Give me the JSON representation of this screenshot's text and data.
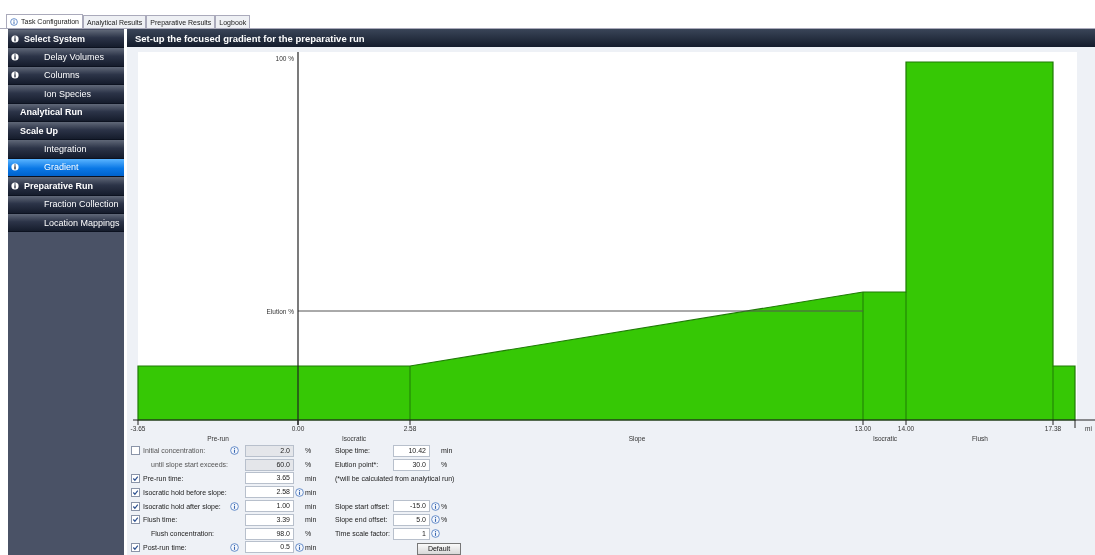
{
  "tabs": [
    {
      "label": "Task Configuration",
      "info": true,
      "selected": true
    },
    {
      "label": "Analytical Results",
      "info": false,
      "selected": false
    },
    {
      "label": "Preparative Results",
      "info": false,
      "selected": false
    },
    {
      "label": "Logbook",
      "info": false,
      "selected": false
    }
  ],
  "sidebar": {
    "items": [
      {
        "label": "Select System",
        "info": true,
        "selected": false,
        "children": [
          {
            "label": "Delay Volumes",
            "info": true,
            "selected": false
          },
          {
            "label": "Columns",
            "info": true,
            "selected": false
          },
          {
            "label": "Ion Species",
            "info": false,
            "selected": false
          }
        ]
      },
      {
        "label": "Analytical Run",
        "info": false,
        "selected": false
      },
      {
        "label": "Scale Up",
        "info": false,
        "selected": false,
        "children": [
          {
            "label": "Integration",
            "info": false,
            "selected": false
          },
          {
            "label": "Gradient",
            "info": true,
            "selected": true
          }
        ]
      },
      {
        "label": "Preparative Run",
        "info": true,
        "selected": false,
        "children": [
          {
            "label": "Fraction Collection",
            "info": false,
            "selected": false
          },
          {
            "label": "Location Mappings",
            "info": false,
            "selected": false
          }
        ]
      }
    ]
  },
  "panel": {
    "title": "Set-up the focused gradient for the preparative run",
    "chart": {
      "y_labels": [
        "100 %",
        "Elution %"
      ],
      "x_tick_labels": [
        "-3.65",
        "0.00",
        "2.58",
        "13.00",
        "14.00",
        "17.38"
      ],
      "x_unit": "mi",
      "segment_labels": [
        "Pre-run",
        "Isocratic",
        "Slope",
        "Isocratic",
        "Flush"
      ]
    },
    "left_fields": [
      {
        "kind": "check",
        "checked": false,
        "label": "Initial concentration:",
        "info_label": true,
        "value": "2.0",
        "disabled": true,
        "info_value": false,
        "unit": "%"
      },
      {
        "kind": "plain",
        "label": "until slope start exceeds:",
        "info_label": false,
        "value": "60.0",
        "disabled": true,
        "info_value": false,
        "unit": "%"
      },
      {
        "kind": "check",
        "checked": true,
        "label": "Pre-run time:",
        "info_label": false,
        "value": "3.65",
        "disabled": false,
        "info_value": false,
        "unit": "min"
      },
      {
        "kind": "check",
        "checked": true,
        "label": "Isocratic hold before slope:",
        "info_label": false,
        "value": "2.58",
        "disabled": false,
        "info_value": true,
        "unit": "min"
      },
      {
        "kind": "check",
        "checked": true,
        "label": "Isocratic hold after slope:",
        "info_label": true,
        "value": "1.00",
        "disabled": false,
        "info_value": false,
        "unit": "min"
      },
      {
        "kind": "check",
        "checked": true,
        "label": "Flush time:",
        "info_label": false,
        "value": "3.39",
        "disabled": false,
        "info_value": false,
        "unit": "min"
      },
      {
        "kind": "plain",
        "label": "Flush concentration:",
        "info_label": false,
        "value": "98.0",
        "disabled": false,
        "info_value": false,
        "unit": "%"
      },
      {
        "kind": "check",
        "checked": true,
        "label": "Post-run time:",
        "info_label": true,
        "value": "0.5",
        "disabled": false,
        "info_value": true,
        "unit": "min"
      }
    ],
    "right_fields": [
      {
        "kind": "field",
        "label": "Slope time:",
        "value": "10.42",
        "info_value": false,
        "unit": "min"
      },
      {
        "kind": "field",
        "label": "Elution point*:",
        "value": "30.0",
        "info_value": false,
        "unit": "%"
      },
      {
        "kind": "note",
        "label": "(*will be calculated from analytical run)"
      },
      {
        "kind": "gap"
      },
      {
        "kind": "field",
        "label": "Slope start offset:",
        "value": "-15.0",
        "info_value": true,
        "unit": "%"
      },
      {
        "kind": "field",
        "label": "Slope end offset:",
        "value": "5.0",
        "info_value": true,
        "unit": "%"
      },
      {
        "kind": "field",
        "label": "Time scale factor:",
        "value": "1",
        "info_value": true
      }
    ],
    "default_button": "Default"
  }
}
